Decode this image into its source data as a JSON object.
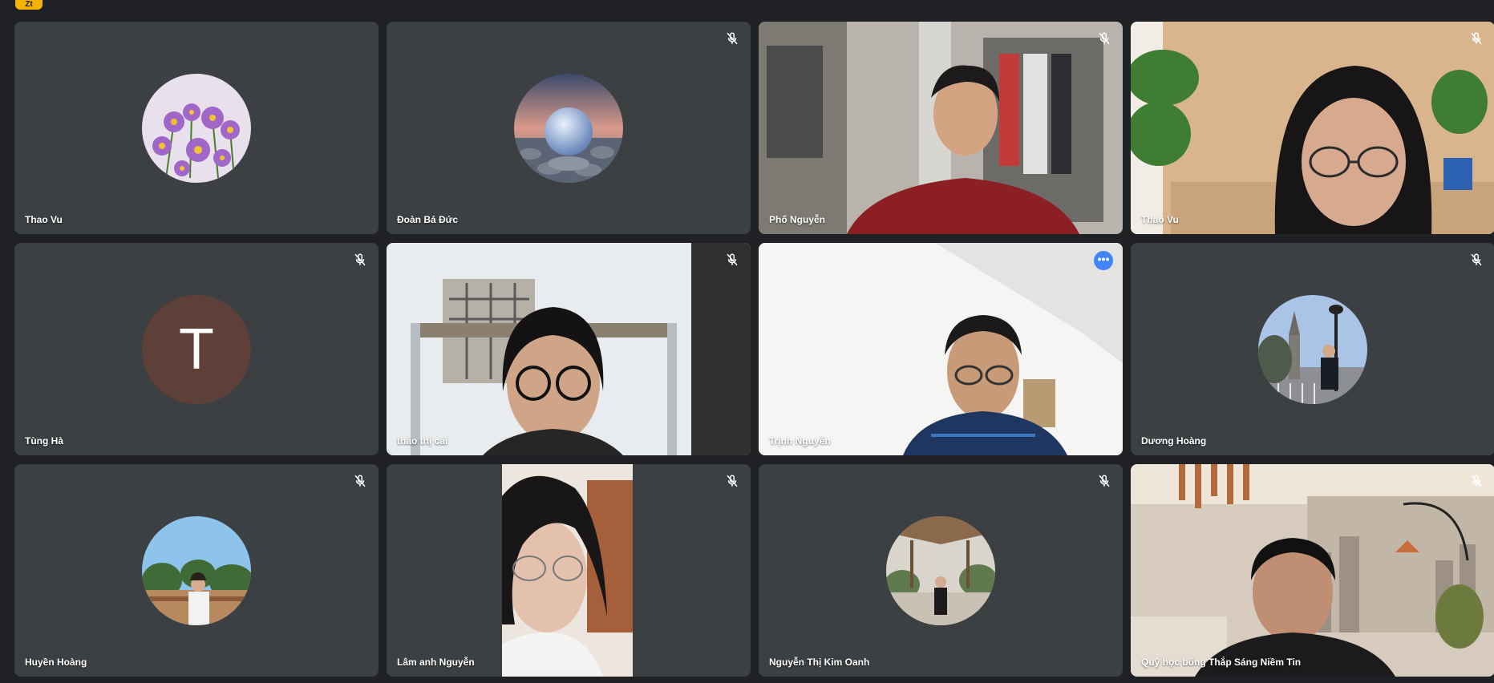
{
  "top_badge": {
    "label": "Zt"
  },
  "participants": [
    {
      "name": "Thao Vu",
      "display": "avatar-photo",
      "avatar_description": "purple aster flowers",
      "muted": false
    },
    {
      "name": "Đoàn Bá Đức",
      "display": "avatar-photo",
      "avatar_description": "crystal ball on pebbles",
      "muted": true
    },
    {
      "name": "Phố Nguyễn",
      "display": "video",
      "muted": true
    },
    {
      "name": "Thao Vu",
      "display": "video",
      "muted": true
    },
    {
      "name": "Tùng Hà",
      "display": "avatar-letter",
      "avatar_letter": "T",
      "muted": true
    },
    {
      "name": "thảo thị cải",
      "display": "video",
      "muted": true
    },
    {
      "name": "Trịnh Nguyễn",
      "display": "video",
      "muted": false,
      "active": true
    },
    {
      "name": "Dương Hoàng",
      "display": "avatar-photo",
      "avatar_description": "person near church",
      "muted": true
    },
    {
      "name": "Huyền Hoàng",
      "display": "avatar-photo",
      "avatar_description": "person outdoors with trees",
      "muted": true
    },
    {
      "name": "Lâm anh Nguyễn",
      "display": "video",
      "muted": true
    },
    {
      "name": "Nguyễn Thị Kim Oanh",
      "display": "avatar-photo",
      "avatar_description": "person under thatched hut",
      "muted": true
    },
    {
      "name": "Quỹ học bổng Thắp Sáng Niềm Tin",
      "display": "video",
      "muted": true
    }
  ],
  "icons": {
    "mute": "mic-off-icon",
    "more": "more-options-icon"
  },
  "colors": {
    "background": "#202124",
    "tile": "#3c4043",
    "active_border": "#8ab4f8",
    "more_button": "#4285f4",
    "letter_avatar": "#5d4037"
  }
}
